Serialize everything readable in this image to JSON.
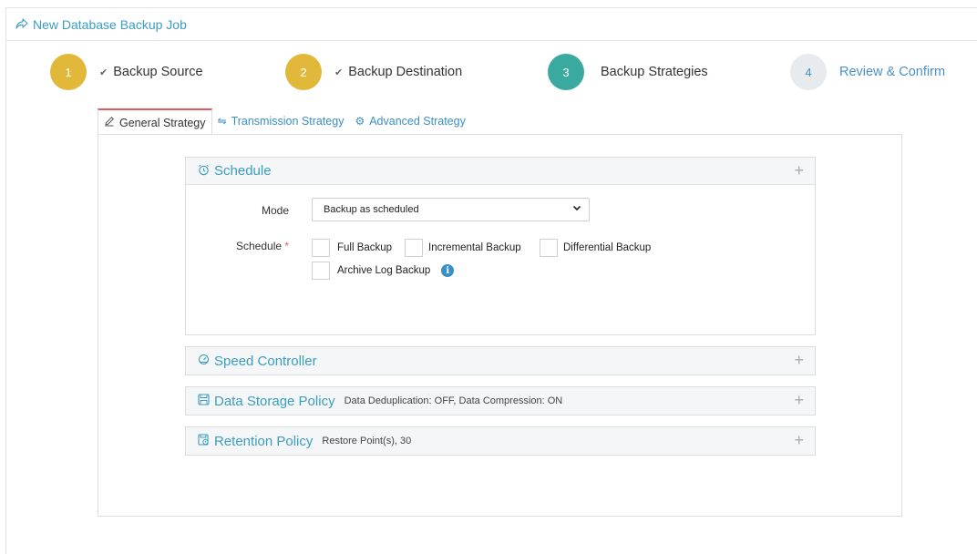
{
  "header": {
    "title": "New Database Backup Job",
    "icon": "share-arrow-icon"
  },
  "wizard": {
    "steps": [
      {
        "number": "1",
        "label": "Backup Source",
        "state": "done",
        "color": "#e2b83b"
      },
      {
        "number": "2",
        "label": "Backup Destination",
        "state": "done",
        "color": "#e2b83b"
      },
      {
        "number": "3",
        "label": "Backup Strategies",
        "state": "active",
        "color": "#3aa99f"
      },
      {
        "number": "4",
        "label": "Review & Confirm",
        "state": "pending",
        "color": "#e8ebee"
      }
    ]
  },
  "tabs": [
    {
      "label": "General Strategy",
      "icon": "pencil-icon",
      "active": true
    },
    {
      "label": "Transmission Strategy",
      "icon": "transfer-arrows-icon",
      "active": false
    },
    {
      "label": "Advanced Strategy",
      "icon": "gear-icon",
      "active": false
    }
  ],
  "schedule": {
    "title": "Schedule",
    "icon": "alarm-clock-icon",
    "mode_label": "Mode",
    "mode_value": "Backup as scheduled",
    "schedule_label": "Schedule",
    "required_mark": "*",
    "options": [
      {
        "label": "Full Backup",
        "checked": false
      },
      {
        "label": "Incremental Backup",
        "checked": false
      },
      {
        "label": "Differential Backup",
        "checked": false
      },
      {
        "label": "Archive Log Backup",
        "checked": false
      }
    ]
  },
  "speed": {
    "title": "Speed Controller",
    "icon": "speedometer-icon"
  },
  "storage": {
    "title": "Data Storage Policy",
    "subtitle": "Data Deduplication: OFF, Data Compression: ON",
    "icon": "floppy-disk-icon"
  },
  "retention": {
    "title": "Retention Policy",
    "subtitle": "Restore Point(s), 30",
    "icon": "save-policy-icon"
  },
  "colors": {
    "accent": "#3a9ec0",
    "active_tab_border": "#e35d5d"
  }
}
